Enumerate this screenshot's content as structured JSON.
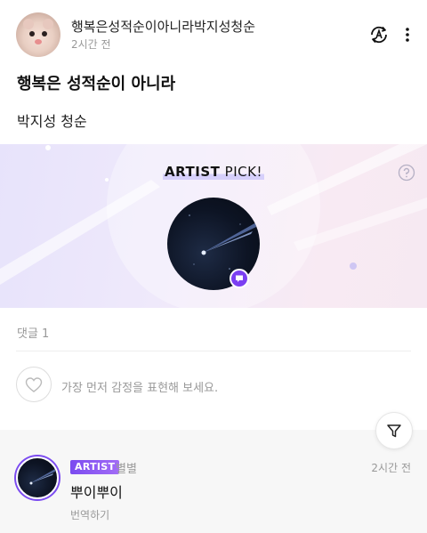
{
  "post": {
    "author": "행복은성적순이아니라박지성청순",
    "time": "2시간 전",
    "title": "행복은 성적순이 아니라",
    "body": "박지성 청순"
  },
  "icons": {
    "translate": "translate-icon",
    "more": "more-vertical-icon",
    "help": "question-icon",
    "chat": "chat-bubble-icon",
    "heart": "heart-icon",
    "filter": "filter-icon"
  },
  "artist_pick": {
    "title_bold": "ARTIST",
    "title_regular": " PICK!"
  },
  "comments": {
    "count_label": "댓글 1",
    "reaction_prompt": "가장 먼저 감정을 표현해 보세요.",
    "items": [
      {
        "badge": "ARTIST",
        "author": "별별",
        "time": "2시간 전",
        "text": "뿌이뿌이",
        "translate_label": "번역하기"
      }
    ]
  },
  "colors": {
    "accent": "#7b3ff2",
    "muted_text": "#999999",
    "banner_start": "#e7e3fb",
    "banner_end": "#f6e9f2"
  }
}
